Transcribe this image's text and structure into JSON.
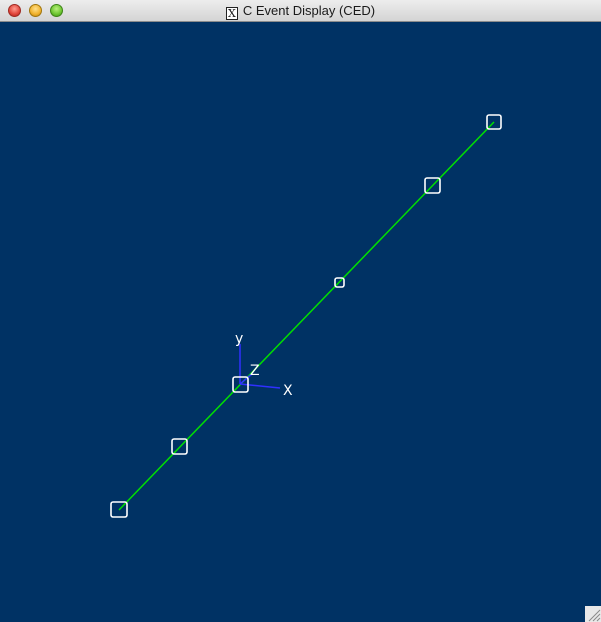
{
  "window": {
    "title": "C Event Display (CED)",
    "title_icon_glyph": "X",
    "buttons": [
      "close",
      "minimize",
      "zoom"
    ]
  },
  "viewport": {
    "background_color": "#003264",
    "track_color": "#00e000",
    "hit_box_color": "#ffffff",
    "axes": {
      "x_label": "X",
      "y_label": "y",
      "z_label": "Z",
      "color": "#3030ff"
    },
    "hits_count": 6
  }
}
